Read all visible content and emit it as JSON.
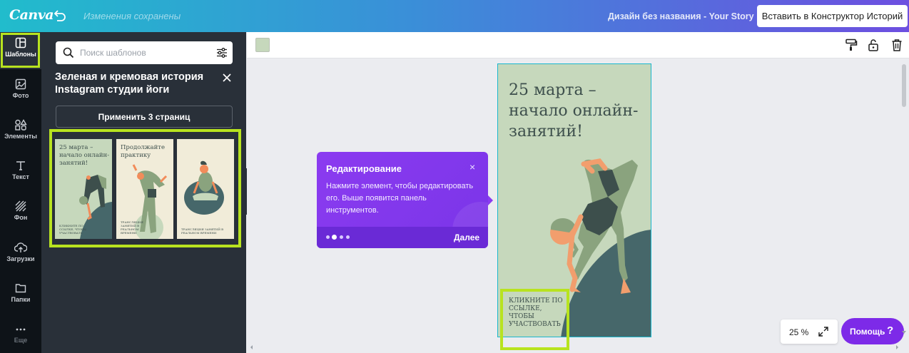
{
  "topbar": {
    "logo": "Canva",
    "status": "Изменения сохранены",
    "document_title": "Дизайн без названия - Your Story",
    "insert_button": "Вставить в Конструктор Историй"
  },
  "leftnav": {
    "items": [
      {
        "label": "Шаблоны",
        "icon": "templates-icon",
        "active": true
      },
      {
        "label": "Фото",
        "icon": "photo-icon"
      },
      {
        "label": "Элементы",
        "icon": "elements-icon"
      },
      {
        "label": "Текст",
        "icon": "text-icon"
      },
      {
        "label": "Фон",
        "icon": "background-icon"
      },
      {
        "label": "Загрузки",
        "icon": "upload-icon"
      },
      {
        "label": "Папки",
        "icon": "folder-icon"
      },
      {
        "label": "Еще",
        "icon": "more-icon"
      }
    ]
  },
  "panel": {
    "search_placeholder": "Поиск шаблонов",
    "title": "Зеленая и кремовая история Instagram студии йоги",
    "apply_button": "Применить 3 страниц",
    "thumbnails": [
      {
        "text": "25 марта – начало онлайн-занятий!",
        "foot": "КЛИКНИТЕ ПО ССЫЛКЕ, ЧТОБЫ УЧАСТВОВАТЬ",
        "bg": "#c6d8bc"
      },
      {
        "text": "Продолжайте практику",
        "foot": "ТРАНСЛЯЦИЯ ЗАНЯТИЙ В РЕАЛЬНОМ ВРЕМЕНИ",
        "bg": "#f1ecd9"
      },
      {
        "text": "",
        "foot": "ТРАНСЛЯЦИЯ ЗАНЯТИЙ В РЕАЛЬНОМ ВРЕМЕНИ",
        "bg": "#f1ecd9"
      }
    ]
  },
  "tooltip": {
    "title": "Редактирование",
    "body": "Нажмите элемент, чтобы редактировать его. Выше появится панель инструментов.",
    "next": "Далее",
    "close": "×",
    "step": 2,
    "steps": 4
  },
  "canvas": {
    "heading": "25 марта – начало онлайн-занятий!",
    "footer": "КЛИКНИТЕ ПО ССЫЛКЕ, ЧТОБЫ УЧАСТВОВАТЬ",
    "page_color": "#c6d8bc"
  },
  "bottom": {
    "zoom": "25 %",
    "help": "Помощь",
    "help_icon": "?"
  },
  "colors": {
    "accent_highlight": "#b8e31f",
    "purple": "#7d2ae8",
    "dark_panel": "#293039"
  }
}
